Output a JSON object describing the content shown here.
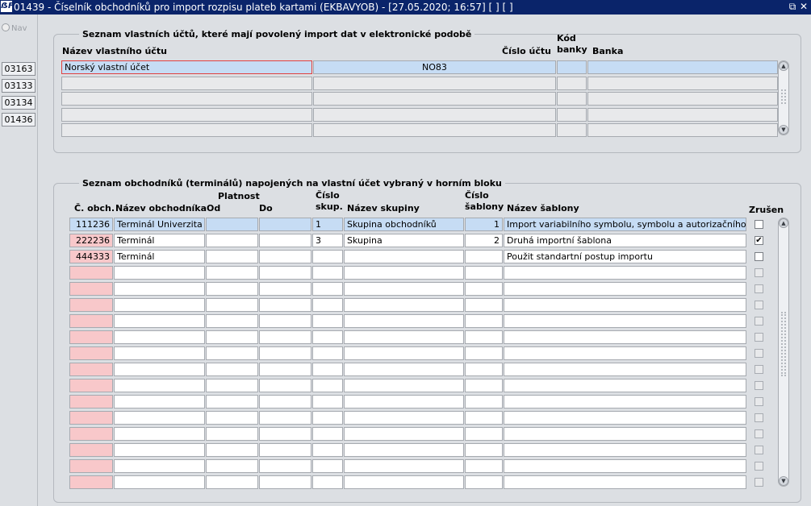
{
  "window": {
    "icon_text": "ẞF",
    "title": "01439 - Číselník obchodníků pro import rozpisu plateb kartami (EKBAVYOB) - [27.05.2020; 16:57]  [ ]  [ ]",
    "restore_glyph": "⧉",
    "close_glyph": "✕"
  },
  "sidebar": {
    "nav_label": "Nav",
    "buttons": [
      "03163",
      "03133",
      "03134",
      "01436"
    ]
  },
  "accounts": {
    "group_title": "Seznam vlastních účtů, které mají povolený import dat v elektronické podobě",
    "headers": {
      "name": "Název vlastního účtu",
      "number": "Číslo účtu",
      "bank_code": "Kód\nbanky",
      "bank": "Banka"
    },
    "rows": [
      {
        "name": "Norský vlastní účet",
        "number": "NO83",
        "bank_code": "",
        "bank": ""
      },
      {
        "name": "",
        "number": "",
        "bank_code": "",
        "bank": ""
      },
      {
        "name": "",
        "number": "",
        "bank_code": "",
        "bank": ""
      },
      {
        "name": "",
        "number": "",
        "bank_code": "",
        "bank": ""
      },
      {
        "name": "",
        "number": "",
        "bank_code": "",
        "bank": ""
      }
    ]
  },
  "merchants": {
    "group_title": "Seznam obchodníků (terminálů) napojených na vlastní účet vybraný v horním bloku",
    "headers": {
      "id": "Č. obch.",
      "name": "Název obchodníka",
      "validity": "Platnost",
      "from": "Od",
      "to": "Do",
      "group_no": "Číslo\nskup.",
      "group_name": "Název skupiny",
      "template_no": "Číslo\nšablony",
      "template_name": "Název šablony",
      "cancelled": "Zrušen"
    },
    "rows": [
      {
        "id": "111236",
        "name": "Terminál Univerzita",
        "from": "",
        "to": "",
        "group_no": "1",
        "group_name": "Skupina obchodníků",
        "template_no": "1",
        "template_name": "Import variabilního symbolu, symbolu a autorizačního kódu dle",
        "cancelled": false
      },
      {
        "id": "222236",
        "name": "Terminál",
        "from": "",
        "to": "",
        "group_no": "3",
        "group_name": "Skupina",
        "template_no": "2",
        "template_name": "Druhá importní šablona",
        "cancelled": true
      },
      {
        "id": "444333",
        "name": "Terminál",
        "from": "",
        "to": "",
        "group_no": "",
        "group_name": "",
        "template_no": "",
        "template_name": "Použit standartní postup importu",
        "cancelled": false
      }
    ],
    "empty_row_count": 14
  }
}
